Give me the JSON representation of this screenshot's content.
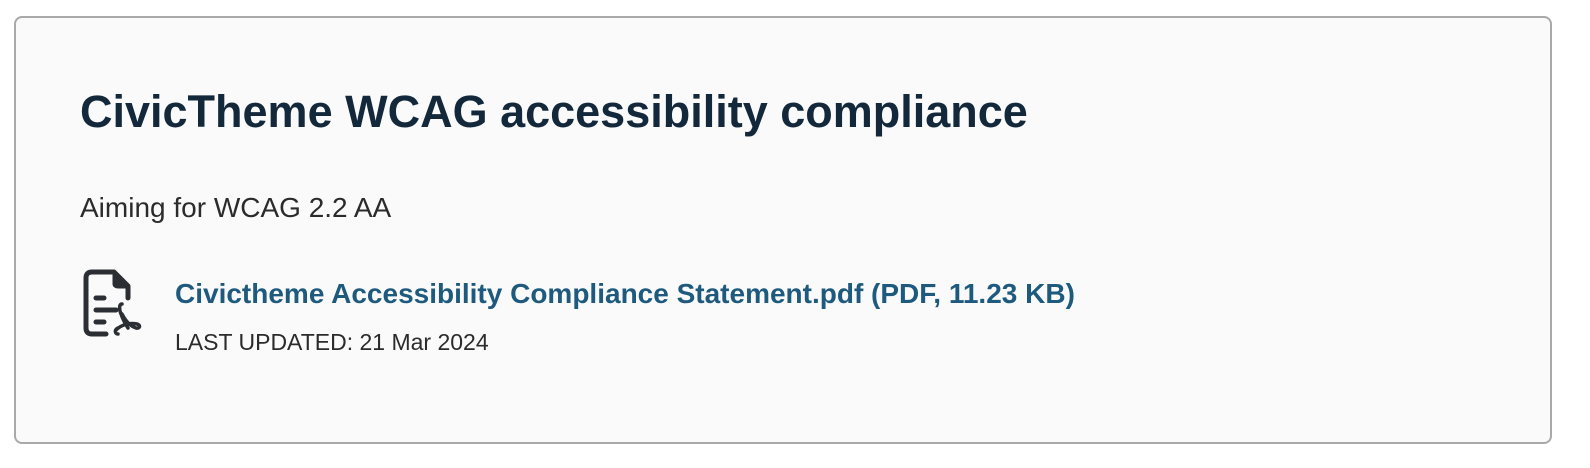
{
  "card": {
    "title": "CivicTheme WCAG accessibility compliance",
    "subtitle": "Aiming for WCAG 2.2 AA",
    "attachment": {
      "icon": "document-pdf-icon",
      "link_text": "Civictheme Accessibility Compliance Statement.pdf (PDF, 11.23 KB)",
      "last_updated": "LAST UPDATED: 21 Mar 2024"
    }
  },
  "colors": {
    "heading": "#13283b",
    "link": "#1e5a7e",
    "text": "#2b2b2b",
    "card_background": "#fafafa",
    "card_border": "#a9a9a9"
  }
}
